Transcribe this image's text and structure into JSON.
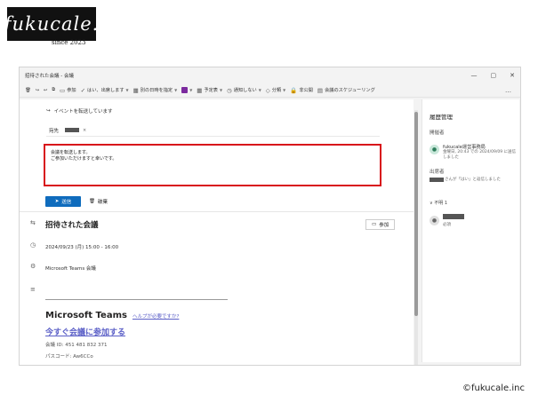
{
  "brand": {
    "logo_text": "fukucale.",
    "since": "since 2023",
    "copyright": "©fukucale.inc"
  },
  "window": {
    "title": "招待された会議 - 会議",
    "controls": [
      "—",
      "▢",
      "✕"
    ]
  },
  "toolbar": {
    "join": "参加",
    "yes": "はい、出席します",
    "propose": "別の日時を指定",
    "schedule": "予定表",
    "notify": "通知しない",
    "category": "分類",
    "private": "非公開",
    "scheduling": "会議のスケジューリング",
    "more": "…"
  },
  "compose": {
    "forwarding_notice": "イベントを転送しています",
    "to_label": "宛先",
    "remove": "×",
    "message_lines": [
      "会議を転送します。",
      "ご参加いただけますと幸いです。"
    ],
    "send": "送信",
    "discard": "破棄"
  },
  "event": {
    "title": "招待された会議",
    "join_button": "参加",
    "datetime": "2024/09/23 (月) 15:00 - 16:00",
    "location": "Microsoft Teams 会議"
  },
  "teams": {
    "title": "Microsoft Teams",
    "help_link": "ヘルプが必要ですか?",
    "join_link": "今すぐ会議に参加する",
    "meeting_id": "会議 ID: 451 481 832 371",
    "passcode": "パスコード: Aw6CCo"
  },
  "side": {
    "title": "履歴管理",
    "organizer_label": "開催者",
    "organizer_name": "fukucale運営事務局",
    "organizer_sent": "金曜日, 20:43 での 2024/09/09 に送信しました",
    "attendees_label": "出席者",
    "attendees_status": "さんが「はい」と返信しました",
    "unknown_label": "∨ 不明 1",
    "unknown_status": "必須"
  },
  "colors": {
    "accent": "#0f6cbd",
    "highlight": "#d8111a",
    "teams_link": "#5b5fc7",
    "logo_bg": "#111111"
  }
}
